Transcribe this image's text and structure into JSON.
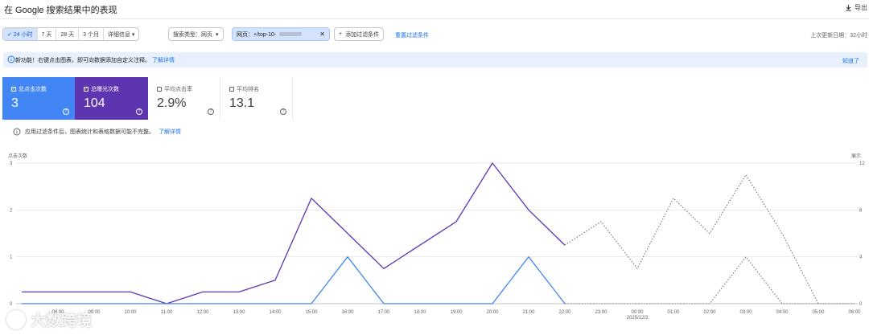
{
  "header": {
    "title": "在 Google 搜索结果中的表现",
    "export_label": "导出",
    "export_icon": "download-icon"
  },
  "filters": {
    "ranges": [
      {
        "label": "24 小时",
        "active": true
      },
      {
        "label": "7 天",
        "active": false
      },
      {
        "label": "28 天",
        "active": false
      },
      {
        "label": "3 个月",
        "active": false
      }
    ],
    "detail_label": "详细信息",
    "search_type_label": "搜索类型：网页",
    "page_filter_label": "网页：+/top-10-",
    "add_filter_label": "添加过滤条件",
    "reset_label": "重置过滤条件",
    "last_updated": "上次更新日期：32小时"
  },
  "banner": {
    "text": "新功能！右键点击图表，即可向数据添加自定义注释。",
    "link": "了解详情",
    "dismiss": "知道了"
  },
  "metrics": [
    {
      "label": "总点击次数",
      "value": "3",
      "checked": true
    },
    {
      "label": "总曝光次数",
      "value": "104",
      "checked": true
    },
    {
      "label": "平均点击率",
      "value": "2.9%",
      "checked": false
    },
    {
      "label": "平均排名",
      "value": "13.1",
      "checked": false
    }
  ],
  "note": {
    "text": "应用过滤条件后，图表统计和表格数据可能不完整。",
    "link": "了解详情"
  },
  "chart_data": {
    "type": "line",
    "left_axis_label": "点击次数",
    "right_axis_label": "展示",
    "ylim_left": [
      0,
      3
    ],
    "ylim_right": [
      0,
      12
    ],
    "left_ticks": [
      "0",
      "1",
      "2",
      "3"
    ],
    "right_ticks": [
      "0",
      "4",
      "8",
      "12"
    ],
    "x_tick_labels": [
      "",
      "08:00",
      "09:00",
      "10:00",
      "11:00",
      "12:00",
      "13:00",
      "14:00",
      "15:00",
      "16:00",
      "17:00",
      "18:00",
      "19:00",
      "20:00",
      "21:00",
      "22:00",
      "23:00",
      "00:00",
      "01:00",
      "02:00",
      "03:00",
      "04:00",
      "05:00",
      "06:00"
    ],
    "date_label": "2025/12/3",
    "clicks": [
      0,
      0,
      0,
      0,
      0,
      0,
      0,
      0,
      0,
      1,
      0,
      0,
      0,
      0,
      1,
      0,
      0,
      0,
      0,
      0,
      1,
      0,
      0,
      0
    ],
    "impressions": [
      1,
      1,
      1,
      1,
      0,
      1,
      1,
      2,
      9,
      6,
      3,
      5,
      7,
      12,
      8,
      5,
      7,
      3,
      9,
      6,
      11,
      6,
      0,
      0
    ],
    "complete_points": 16,
    "colors": {
      "clicks": "#4285f4",
      "impressions": "#5e35b1",
      "incomplete": "#757575"
    }
  },
  "watermark": {
    "text": "大数跨境"
  }
}
